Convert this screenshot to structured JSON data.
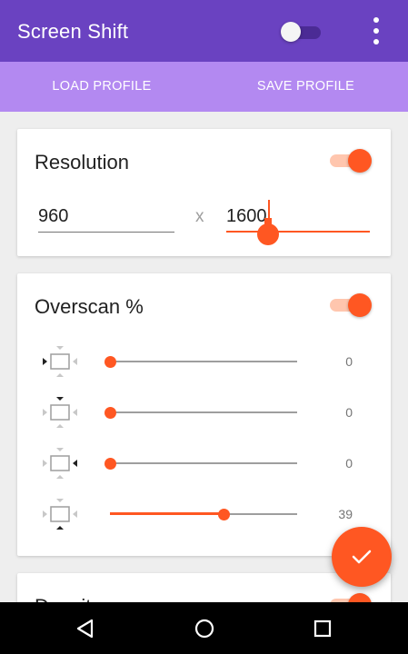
{
  "app": {
    "title": "Screen Shift"
  },
  "header": {
    "master_switch_on": false
  },
  "tabs": {
    "load": "LOAD PROFILE",
    "save": "SAVE PROFILE"
  },
  "resolution": {
    "title": "Resolution",
    "enabled": true,
    "width": "960",
    "separator": "x",
    "height": "1600"
  },
  "overscan": {
    "title": "Overscan %",
    "enabled": true,
    "rows": [
      {
        "icon": "overscan-left-icon",
        "value": 0
      },
      {
        "icon": "overscan-top-icon",
        "value": 0
      },
      {
        "icon": "overscan-right-icon",
        "value": 0
      },
      {
        "icon": "overscan-bottom-icon",
        "value": 39
      }
    ]
  },
  "density": {
    "title": "Density",
    "enabled": true
  },
  "fab": {
    "icon": "check-icon"
  },
  "navbar": {
    "icons": [
      "back-icon",
      "home-icon",
      "recents-icon"
    ]
  },
  "colors": {
    "primary": "#6a42c1",
    "tabs": "#b389f1",
    "accent": "#ff5722"
  }
}
